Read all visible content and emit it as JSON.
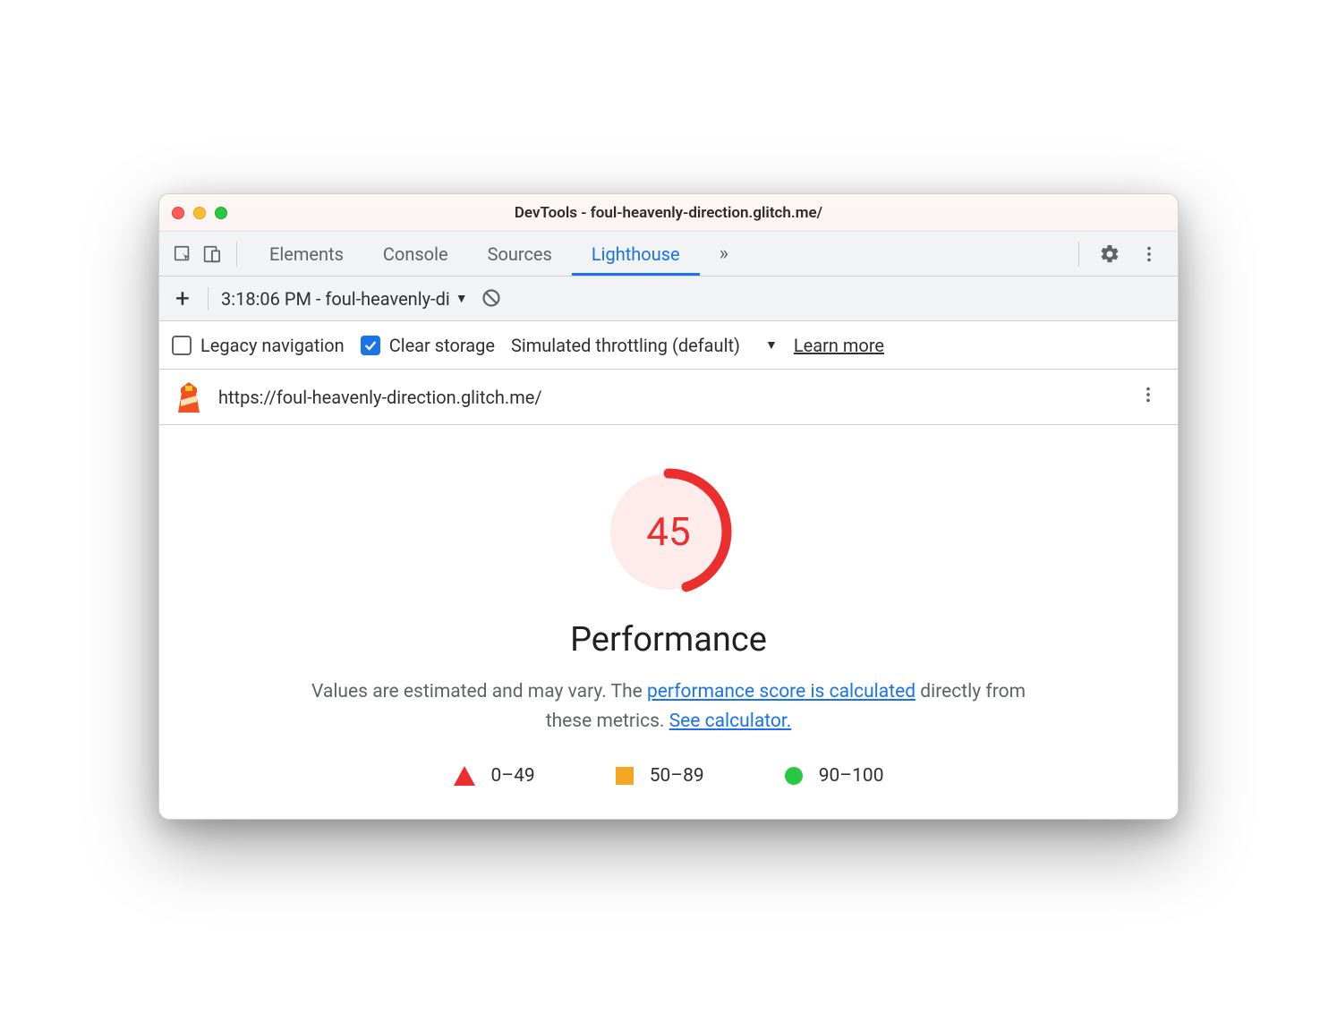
{
  "window": {
    "title": "DevTools - foul-heavenly-direction.glitch.me/"
  },
  "tabs": {
    "items": [
      "Elements",
      "Console",
      "Sources",
      "Lighthouse"
    ],
    "active": "Lighthouse",
    "overflow": "»"
  },
  "toolbar": {
    "plus": "+",
    "report_label": "3:18:06 PM - foul-heavenly-di"
  },
  "options": {
    "legacy_nav": {
      "label": "Legacy navigation",
      "checked": false
    },
    "clear_storage": {
      "label": "Clear storage",
      "checked": true
    },
    "throttling": "Simulated throttling (default)",
    "learn_more": "Learn more"
  },
  "urlbar": {
    "url": "https://foul-heavenly-direction.glitch.me/"
  },
  "report": {
    "score": "45",
    "score_pct": 45,
    "title": "Performance",
    "desc_prefix": "Values are estimated and may vary. The ",
    "link1": "performance score is calculated",
    "desc_mid": " directly from these metrics. ",
    "link2": "See calculator.",
    "legend": {
      "low": "0–49",
      "mid": "50–89",
      "high": "90–100"
    }
  },
  "colors": {
    "accent": "#1a73e8",
    "fail": "#eb2f2f",
    "warn": "#f5a623",
    "pass": "#27c93f"
  }
}
